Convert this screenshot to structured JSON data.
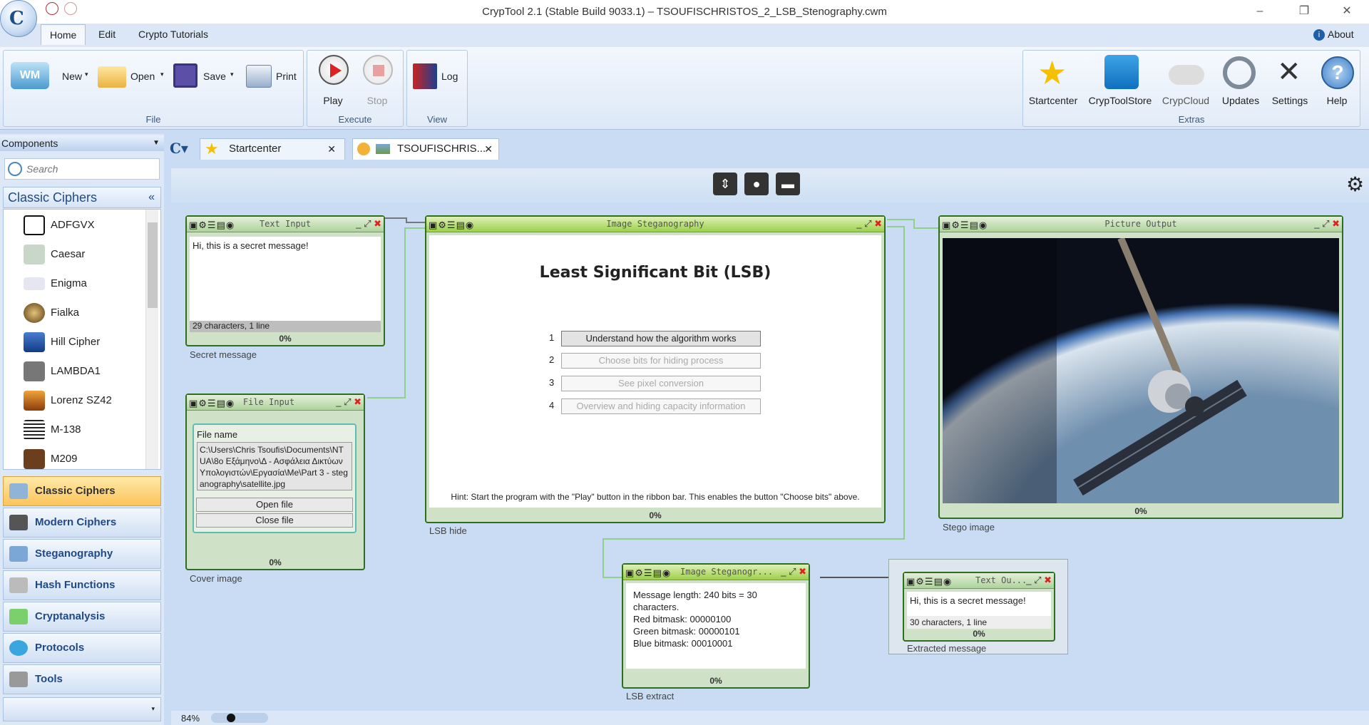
{
  "titlebar": {
    "title": "CrypTool 2.1 (Stable Build 9033.1) – TSOUFISCHRISTOS_2_LSB_Stenography.cwm",
    "minimize": "–",
    "maximize": "❐",
    "close": "✕"
  },
  "ribbon_tabs": {
    "home": "Home",
    "edit": "Edit",
    "tutorials": "Crypto Tutorials",
    "about": "About"
  },
  "ribbon": {
    "file": {
      "label": "File",
      "new": "New",
      "open": "Open",
      "save": "Save",
      "print": "Print"
    },
    "execute": {
      "label": "Execute",
      "play": "Play",
      "stop": "Stop"
    },
    "view": {
      "label": "View",
      "log": "Log"
    },
    "extras": {
      "label": "Extras",
      "startcenter": "Startcenter",
      "store": "CrypToolStore",
      "cloud": "CrypCloud",
      "updates": "Updates",
      "settings": "Settings",
      "help": "Help"
    }
  },
  "left_panel": {
    "header": "Components",
    "search_placeholder": "Search",
    "category_title": "Classic Ciphers",
    "ciphers": [
      "ADFGVX",
      "Caesar",
      "Enigma",
      "Fialka",
      "Hill Cipher",
      "LAMBDA1",
      "Lorenz SZ42",
      "M-138",
      "M209"
    ],
    "categories": [
      "Classic Ciphers",
      "Modern Ciphers",
      "Steganography",
      "Hash Functions",
      "Cryptanalysis",
      "Protocols",
      "Tools"
    ]
  },
  "doc_tabs": {
    "startcenter": "Startcenter",
    "workspace": "TSOUFISCHRIS..."
  },
  "components": {
    "text_input": {
      "title": "Text Input",
      "text": "Hi, this is a secret message!",
      "status": "29 characters,  1 line",
      "pct": "0%",
      "caption": "Secret message"
    },
    "file_input": {
      "title": "File Input",
      "label": "File name",
      "path": "C:\\Users\\Chris Tsoufis\\Documents\\NTUA\\8o Εξάμηνο\\Δ - Ασφάλεια Δικτύων Υπολογιστών\\Εργασία\\Me\\Part 3 - steganography\\satellite.jpg",
      "open": "Open file",
      "close": "Close file",
      "pct": "0%",
      "caption": "Cover image"
    },
    "stego": {
      "title": "Image Steganography",
      "heading": "Least Significant Bit (LSB)",
      "steps": [
        {
          "n": "1",
          "label": "Understand how the algorithm works"
        },
        {
          "n": "2",
          "label": "Choose bits for hiding process"
        },
        {
          "n": "3",
          "label": "See pixel conversion"
        },
        {
          "n": "4",
          "label": "Overview and hiding capacity information"
        }
      ],
      "hint": "Hint: Start the program with the \"Play\" button in the ribbon bar. This enables the button \"Choose bits\" above.",
      "pct": "0%",
      "caption": "LSB hide"
    },
    "picture": {
      "title": "Picture Output",
      "pct": "0%",
      "caption": "Stego image"
    },
    "extract": {
      "title": "Image Steganogr...",
      "lines": [
        "Message length: 240 bits = 30 characters.",
        "Red bitmask: 00000100",
        "Green bitmask: 00000101",
        "Blue bitmask: 00010001"
      ],
      "pct": "0%",
      "caption": "LSB extract"
    },
    "text_output": {
      "title": "Text Ou...",
      "text": "Hi, this is a secret message!",
      "status": "30 characters,  1 line",
      "pct": "0%",
      "caption": "Extracted message"
    }
  },
  "zoom": "84%"
}
